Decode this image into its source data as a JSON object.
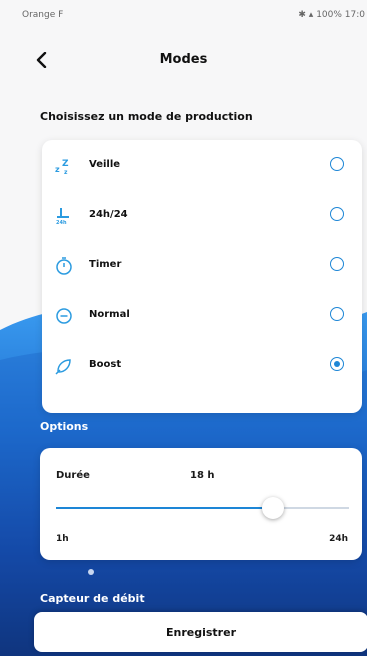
{
  "status_bar": {
    "left": "Orange F",
    "right": "100% 17:0"
  },
  "header": {
    "title": "Modes",
    "back_icon": "chevron-left-icon"
  },
  "modes_section": {
    "title": "Choisissez un mode de production",
    "items": [
      {
        "label": "Veille",
        "icon": "sleep-icon",
        "selected": false
      },
      {
        "label": "24h/24",
        "icon": "clock-24-icon",
        "selected": false
      },
      {
        "label": "Timer",
        "icon": "timer-icon",
        "selected": false
      },
      {
        "label": "Normal",
        "icon": "normal-icon",
        "selected": false
      },
      {
        "label": "Boost",
        "icon": "boost-icon",
        "selected": true
      }
    ]
  },
  "options_section": {
    "title": "Options",
    "duration": {
      "label": "Durée",
      "value": "18 h",
      "min_label": "1h",
      "max_label": "24h",
      "slider_fraction": 0.74
    }
  },
  "flow_sensor_label": "Capteur de débit",
  "save_button": "Enregistrer",
  "colors": {
    "accent": "#1d86d6",
    "wave_light": "#2f8fe6",
    "wave_dark": "#0b2a6b"
  }
}
